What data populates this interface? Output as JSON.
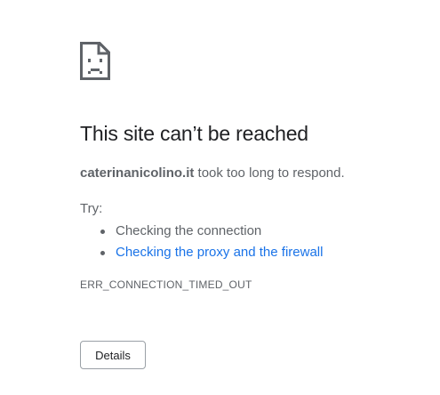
{
  "error": {
    "icon": "sad-page-icon",
    "title": "This site can’t be reached",
    "host": "caterinanicolino.it",
    "summary_suffix": " took too long to respond.",
    "try_label": "Try:",
    "suggestions": [
      {
        "text": "Checking the connection",
        "is_link": false
      },
      {
        "text": "Checking the proxy and the firewall",
        "is_link": true
      }
    ],
    "code": "ERR_CONNECTION_TIMED_OUT",
    "details_button": "Details"
  },
  "colors": {
    "text": "#202124",
    "secondary_text": "#5f6368",
    "link": "#1a73e8",
    "button_border": "#9aa0a6"
  }
}
